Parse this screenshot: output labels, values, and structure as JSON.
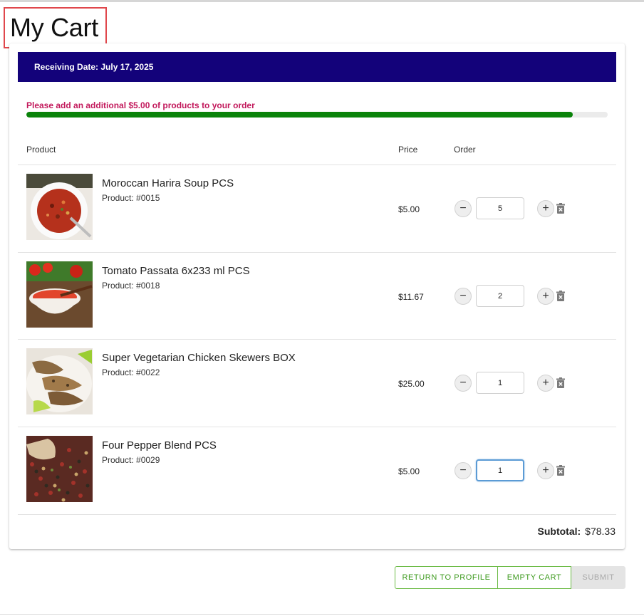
{
  "page": {
    "title": "My Cart"
  },
  "banner": {
    "receiving_date": "Receiving Date: July 17, 2025"
  },
  "minimum_order": {
    "message": "Please add an additional $5.00 of products to your order",
    "progress_fraction": 0.94,
    "bar_color": "#0a830a"
  },
  "table": {
    "headers": {
      "product": "Product",
      "price": "Price",
      "order": "Order"
    }
  },
  "items": [
    {
      "name": "Moroccan Harira Soup PCS",
      "code": "Product: #0015",
      "price": "$5.00",
      "qty": "5",
      "image": "harira-soup-image"
    },
    {
      "name": "Tomato Passata 6x233 ml PCS",
      "code": "Product: #0018",
      "price": "$11.67",
      "qty": "2",
      "image": "tomato-passata-image"
    },
    {
      "name": "Super Vegetarian Chicken Skewers BOX",
      "code": "Product: #0022",
      "price": "$25.00",
      "qty": "1",
      "image": "chicken-skewers-image"
    },
    {
      "name": "Four Pepper Blend PCS",
      "code": "Product: #0029",
      "price": "$5.00",
      "qty": "1",
      "image": "pepper-blend-image"
    }
  ],
  "icons": {
    "decrease": "minus-icon",
    "increase": "plus-icon",
    "delete": "trash-icon"
  },
  "stepper": {
    "minus_label": "−",
    "plus_label": "+"
  },
  "summary": {
    "subtotal_label": "Subtotal:",
    "subtotal_value": "$78.33"
  },
  "actions": {
    "return_label": "RETURN TO PROFILE",
    "empty_label": "EMPTY CART",
    "submit_label": "SUBMIT"
  },
  "colors": {
    "banner": "#13027a",
    "warning_text": "#c2185b",
    "button_accent": "#3d9a1e"
  }
}
